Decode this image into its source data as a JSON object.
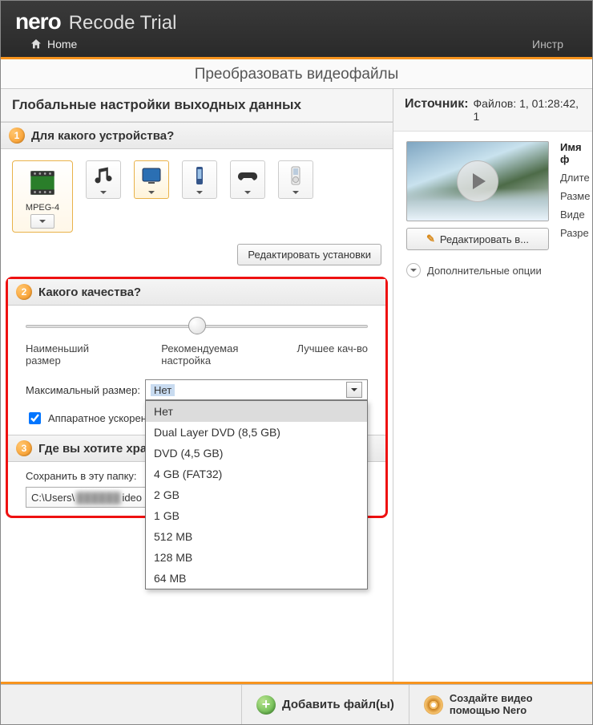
{
  "app": {
    "logo": "nero",
    "product": "Recode Trial"
  },
  "nav": {
    "home": "Home",
    "right": "Инстр"
  },
  "subtitle": "Преобразовать видеофайлы",
  "left": {
    "title": "Глобальные настройки выходных данных",
    "s1": {
      "num": "1",
      "label": "Для какого устройства?",
      "selected_label": "MPEG-4",
      "edit": "Редактировать установки"
    },
    "s2": {
      "num": "2",
      "label": "Какого качества?",
      "slider": {
        "lo": "Наименьший размер",
        "mid": "Рекомендуемая настройка",
        "hi": "Лучшее кач-во"
      },
      "max_label": "Максимальный размер:",
      "max_selected": "Нет",
      "options": [
        "Нет",
        "Dual Layer DVD (8,5 GB)",
        "DVD (4,5 GB)",
        "4 GB (FAT32)",
        "2 GB",
        "1 GB",
        "512 MB",
        "128 MB",
        "64 MB"
      ],
      "hw": "Аппаратное ускорен"
    },
    "s3": {
      "num": "3",
      "label": "Где вы хотите хран",
      "save_label": "Сохранить в эту папку:",
      "path_pre": "C:\\Users\\",
      "path_blur": "██████",
      "path_post": "ideo"
    }
  },
  "right": {
    "source": "Источник:",
    "source_info": "Файлов: 1, 01:28:42, 1",
    "meta": {
      "name": "Имя ф",
      "m1": "Длите",
      "m2": "Разме",
      "m3": "Виде",
      "m4": "Разре"
    },
    "edit": "Редактировать в...",
    "opts": "Дополнительные опции"
  },
  "footer": {
    "add": "Добавить файл(ы)",
    "create1": "Создайте видео",
    "create2": "помощью Nero"
  }
}
